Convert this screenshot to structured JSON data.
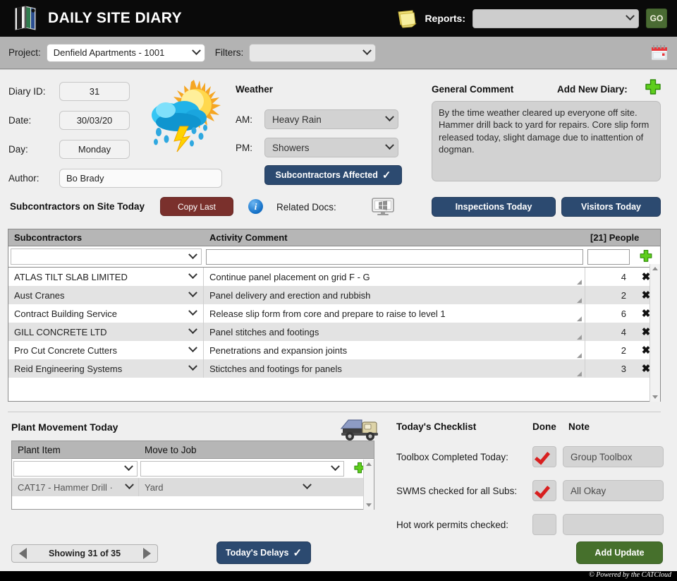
{
  "topbar": {
    "title": "DAILY SITE DIARY",
    "logo_icon": "diary-book-icon",
    "notes_icon": "sticky-notes-icon",
    "reports_label": "Reports:",
    "reports_value": "",
    "go_label": "GO"
  },
  "projectbar": {
    "project_label": "Project:",
    "project_value": "Denfield Apartments - 1001",
    "filters_label": "Filters:",
    "filters_value": "",
    "calendar_icon": "calendar-icon"
  },
  "diary": {
    "id_label": "Diary ID:",
    "id_value": "31",
    "date_label": "Date:",
    "date_value": "30/03/20",
    "day_label": "Day:",
    "day_value": "Monday",
    "author_label": "Author:",
    "author_value": "Bo Brady",
    "weather_icon": "sun-cloud-rain-icon"
  },
  "weather": {
    "title": "Weather",
    "am_label": "AM:",
    "am_value": "Heavy Rain",
    "pm_label": "PM:",
    "pm_value": "Showers",
    "subs_affected_label": "Subcontractors Affected",
    "subs_affected_check": "✓"
  },
  "general_comment": {
    "title": "General Comment",
    "add_new_label": "Add New Diary:",
    "add_icon": "plus-icon",
    "text": "By the time weather cleared up everyone off site. Hammer drill back to yard for repairs. Core slip form released today, slight damage due to inattention of dogman."
  },
  "subs_bar": {
    "title": "Subcontractors on Site Today",
    "copy_last_label": "Copy Last",
    "info_icon": "info-icon",
    "info_glyph": "i",
    "related_docs_label": "Related Docs:",
    "docs_icon": "monitor-icon",
    "inspections_label": "Inspections Today",
    "visitors_label": "Visitors Today"
  },
  "subs_table": {
    "headers": {
      "subcontractors": "Subcontractors",
      "activity": "Activity Comment",
      "people": "[21] People"
    },
    "new_row": {
      "sub_value": "",
      "activity_value": "",
      "people_value": "",
      "add_icon": "plus-icon"
    },
    "rows": [
      {
        "sub": "ATLAS TILT SLAB LIMITED",
        "activity": "Continue panel placement on grid F - G",
        "people": "4",
        "delete": "✖"
      },
      {
        "sub": "Aust Cranes",
        "activity": "Panel delivery and erection and rubbish",
        "people": "2",
        "delete": "✖"
      },
      {
        "sub": "Contract Building Service",
        "activity": "Release slip form from core and prepare to raise to level 1",
        "people": "6",
        "delete": "✖"
      },
      {
        "sub": "GILL CONCRETE LTD",
        "activity": "Panel stitches and footings",
        "people": "4",
        "delete": "✖"
      },
      {
        "sub": "Pro Cut Concrete Cutters",
        "activity": "Penetrations and expansion joints",
        "people": "2",
        "delete": "✖"
      },
      {
        "sub": "Reid Engineering Systems",
        "activity": "Stictches and footings for panels",
        "people": "3",
        "delete": "✖"
      }
    ]
  },
  "plant": {
    "title": "Plant Movement Today",
    "truck_icon": "dump-truck-icon",
    "headers": {
      "item": "Plant Item",
      "move": "Move to Job"
    },
    "new_row": {
      "item_value": "",
      "move_value": "",
      "add_icon": "plus-icon"
    },
    "rows": [
      {
        "item": "CAT17 - Hammer Drill ·",
        "move": "Yard"
      }
    ]
  },
  "checklist": {
    "title": "Today's Checklist",
    "done_header": "Done",
    "note_header": "Note",
    "items": [
      {
        "label": "Toolbox Completed Today:",
        "done": true,
        "note": "Group Toolbox"
      },
      {
        "label": "SWMS checked for all Subs:",
        "done": true,
        "note": "All Okay"
      },
      {
        "label": "Hot work permits checked:",
        "done": false,
        "note": ""
      }
    ]
  },
  "footerbar": {
    "pager_prev_icon": "previous-arrow-icon",
    "pager_text": "Showing 31 of 35",
    "pager_next_icon": "next-arrow-icon",
    "delays_label": "Today's Delays",
    "delays_check": "✓",
    "add_update_label": "Add Update",
    "credit": "© Powered by the CATCloud"
  },
  "colors": {
    "navy": "#2c4a70",
    "maroon": "#7a302c",
    "green": "#46702c",
    "go_green": "#4a6b33",
    "plus_green": "#52c41a",
    "tick_red": "#d81f1f",
    "header_grey": "#b6b6b6",
    "panel_grey": "#efefef",
    "bar_grey": "#b3b3b3"
  }
}
